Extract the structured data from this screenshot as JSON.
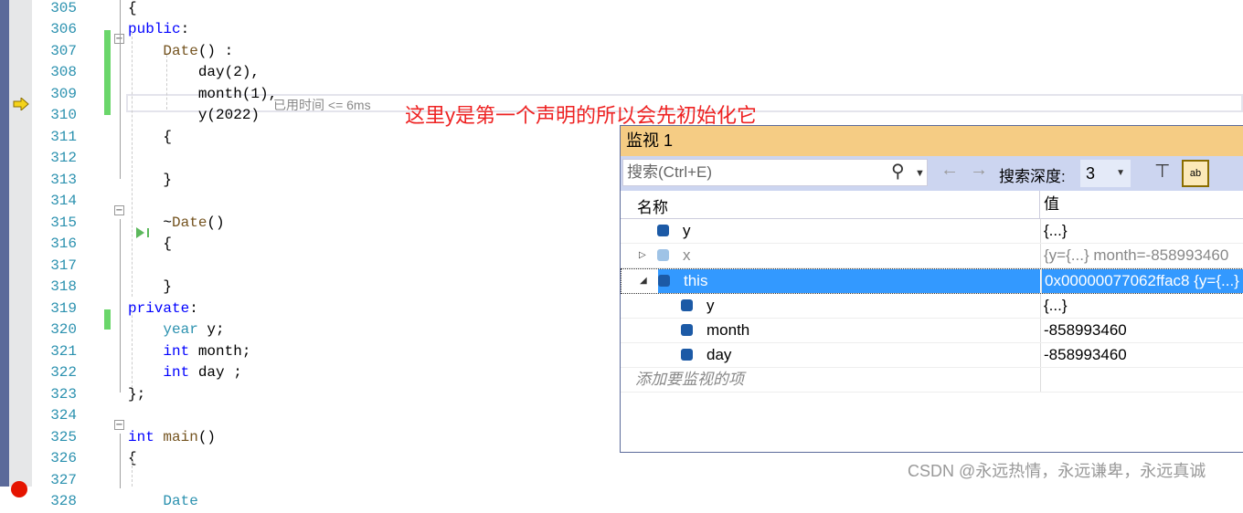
{
  "editor": {
    "line_numbers": [
      "305",
      "306",
      "307",
      "308",
      "309",
      "310",
      "311",
      "312",
      "313",
      "314",
      "315",
      "316",
      "317",
      "318",
      "319",
      "320",
      "321",
      "322",
      "323",
      "324",
      "325",
      "326",
      "327",
      "328"
    ],
    "lines": [
      [
        {
          "t": "{",
          "c": "pl"
        }
      ],
      [
        {
          "t": "public",
          "c": "kw"
        },
        {
          "t": ":",
          "c": "pl"
        }
      ],
      [
        {
          "t": "    ",
          "c": "pl"
        },
        {
          "t": "Date",
          "c": "fn"
        },
        {
          "t": "() :",
          "c": "pl"
        }
      ],
      [
        {
          "t": "        day(2),",
          "c": "pl"
        }
      ],
      [
        {
          "t": "        month(1),",
          "c": "pl"
        }
      ],
      [
        {
          "t": "        y(2022)",
          "c": "pl"
        }
      ],
      [
        {
          "t": "    {",
          "c": "pl"
        }
      ],
      [
        {
          "t": "",
          "c": "pl"
        }
      ],
      [
        {
          "t": "    }",
          "c": "pl"
        }
      ],
      [
        {
          "t": "",
          "c": "pl"
        }
      ],
      [
        {
          "t": "    ~",
          "c": "pl"
        },
        {
          "t": "Date",
          "c": "fn"
        },
        {
          "t": "()",
          "c": "pl"
        }
      ],
      [
        {
          "t": "    {",
          "c": "pl"
        }
      ],
      [
        {
          "t": "",
          "c": "pl"
        }
      ],
      [
        {
          "t": "    }",
          "c": "pl"
        }
      ],
      [
        {
          "t": "private",
          "c": "kw"
        },
        {
          "t": ":",
          "c": "pl"
        }
      ],
      [
        {
          "t": "    ",
          "c": "pl"
        },
        {
          "t": "year",
          "c": "ty"
        },
        {
          "t": " y;",
          "c": "pl"
        }
      ],
      [
        {
          "t": "    ",
          "c": "pl"
        },
        {
          "t": "int",
          "c": "kw"
        },
        {
          "t": " month;",
          "c": "pl"
        }
      ],
      [
        {
          "t": "    ",
          "c": "pl"
        },
        {
          "t": "int",
          "c": "kw"
        },
        {
          "t": " day ;",
          "c": "pl"
        }
      ],
      [
        {
          "t": "};",
          "c": "pl"
        }
      ],
      [
        {
          "t": "",
          "c": "pl"
        }
      ],
      [
        {
          "t": "int",
          "c": "kw"
        },
        {
          "t": " ",
          "c": "pl"
        },
        {
          "t": "main",
          "c": "fn"
        },
        {
          "t": "()",
          "c": "pl"
        }
      ],
      [
        {
          "t": "{",
          "c": "pl"
        }
      ],
      [
        {
          "t": "",
          "c": "pl"
        }
      ],
      [
        {
          "t": "    Date",
          "c": "ty"
        }
      ]
    ],
    "elapsed_hint": "已用时间 <= 6ms",
    "annotation": "这里y是第一个声明的所以会先初始化它"
  },
  "watch": {
    "title": "监视 1",
    "search_placeholder": "搜索(Ctrl+E)",
    "depth_label": "搜索深度:",
    "depth_value": "3",
    "col_name": "名称",
    "col_value": "值",
    "rows": [
      {
        "name": "y",
        "value": "{...}",
        "level": 0,
        "icon": "field-icon"
      },
      {
        "name": "x",
        "value": "{y={...} month=-858993460",
        "level": 0,
        "icon": "object-icon",
        "expander": "collapsed",
        "dim": true
      },
      {
        "name": "this",
        "value": "0x00000077062ffac8 {y={...}",
        "level": 0,
        "icon": "object-icon",
        "expander": "expanded",
        "selected": true
      },
      {
        "name": "y",
        "value": "{...}",
        "level": 1,
        "icon": "field-icon"
      },
      {
        "name": "month",
        "value": "-858993460",
        "level": 1,
        "icon": "field-icon"
      },
      {
        "name": "day",
        "value": "-858993460",
        "level": 1,
        "icon": "field-icon"
      }
    ],
    "add_item": "添加要监视的项"
  },
  "watermark": "CSDN @永远热情，永远谦卑，永远真诚",
  "colors": {
    "accent": "#3399ff",
    "title_bar": "#f5cc84",
    "annotation": "#ee2222"
  }
}
